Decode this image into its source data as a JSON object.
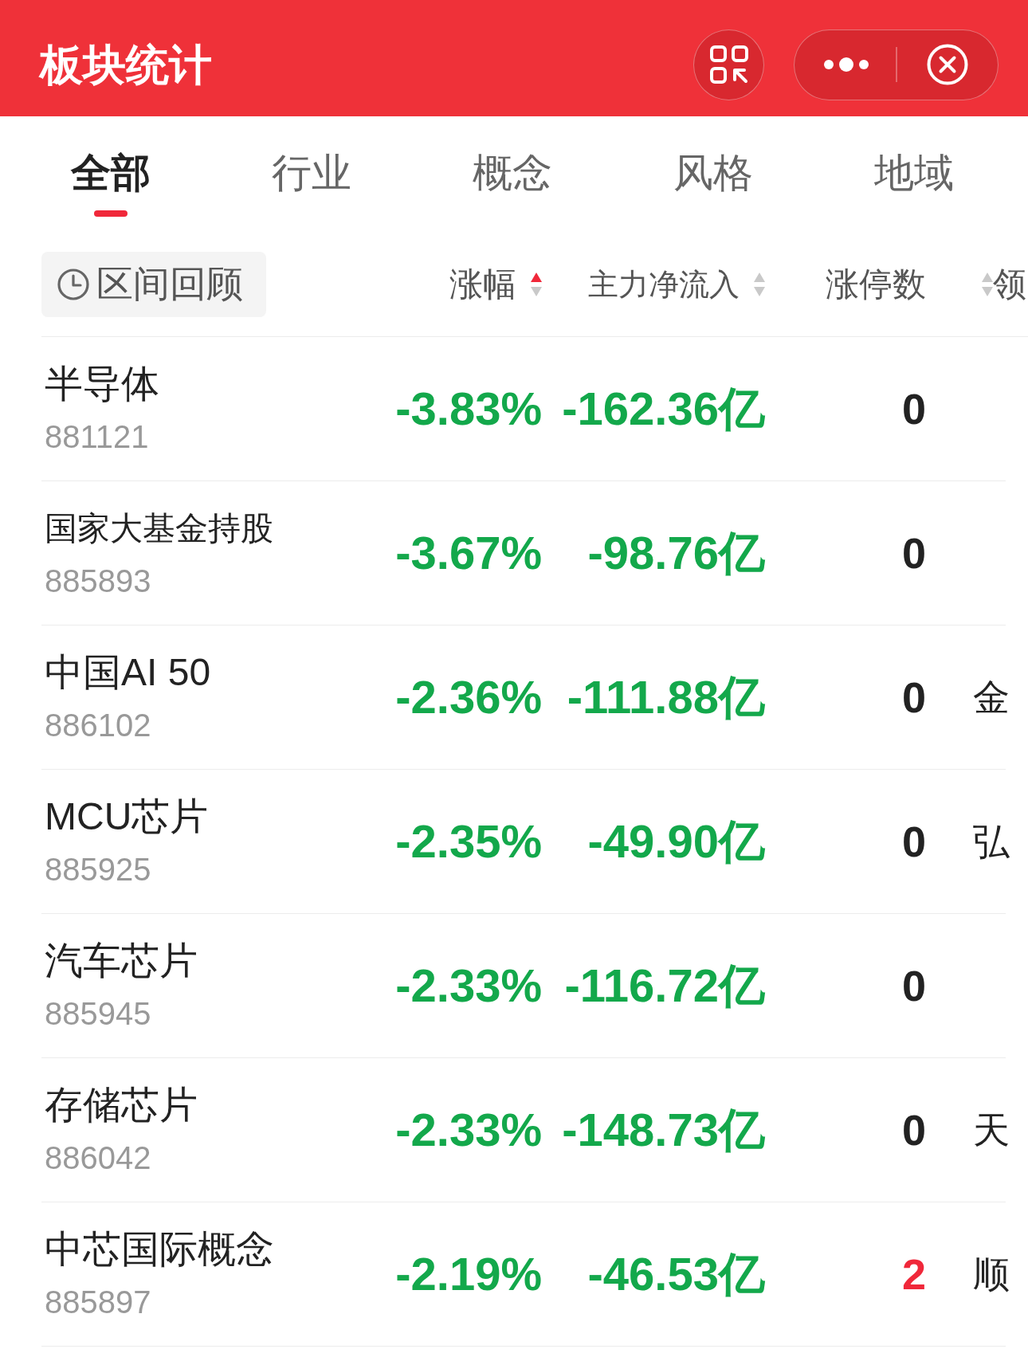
{
  "header": {
    "title": "板块统计"
  },
  "tabs": [
    {
      "label": "全部",
      "selected": true
    },
    {
      "label": "行业",
      "selected": false
    },
    {
      "label": "概念",
      "selected": false
    },
    {
      "label": "风格",
      "selected": false
    },
    {
      "label": "地域",
      "selected": false
    }
  ],
  "filter": {
    "label": "区间回顾"
  },
  "columns": [
    {
      "label": "涨幅",
      "sort_ascending": true,
      "sort_descending": false
    },
    {
      "label": "主力净流入",
      "sort_ascending": false,
      "sort_descending": false
    },
    {
      "label": "涨停数"
    },
    {
      "label": "领",
      "sort_ascending": false,
      "sort_descending": false
    }
  ],
  "rows": [
    {
      "name": "半导体",
      "code": "881121",
      "change": "-3.83%",
      "change_falling": true,
      "inflow": "-162.36亿",
      "inflow_falling": true,
      "limit_up": "0",
      "limit_up_highlighted": false
    },
    {
      "name": "国家大基金持股",
      "code": "885893",
      "change": "-3.67%",
      "change_falling": true,
      "inflow": "-98.76亿",
      "inflow_falling": true,
      "limit_up": "0",
      "limit_up_highlighted": false
    },
    {
      "name": "中国AI 50",
      "code": "886102",
      "change": "-2.36%",
      "change_falling": true,
      "inflow": "-111.88亿",
      "inflow_falling": true,
      "limit_up": "0",
      "limit_up_highlighted": false,
      "leader": "金"
    },
    {
      "name": "MCU芯片",
      "code": "885925",
      "change": "-2.35%",
      "change_falling": true,
      "inflow": "-49.90亿",
      "inflow_falling": true,
      "limit_up": "0",
      "limit_up_highlighted": false,
      "leader": "弘"
    },
    {
      "name": "汽车芯片",
      "code": "885945",
      "change": "-2.33%",
      "change_falling": true,
      "inflow": "-116.72亿",
      "inflow_falling": true,
      "limit_up": "0",
      "limit_up_highlighted": false
    },
    {
      "name": "存储芯片",
      "code": "886042",
      "change": "-2.33%",
      "change_falling": true,
      "inflow": "-148.73亿",
      "inflow_falling": true,
      "limit_up": "0",
      "limit_up_highlighted": false,
      "leader": "天"
    },
    {
      "name": "中芯国际概念",
      "code": "885897",
      "change": "-2.19%",
      "change_falling": true,
      "inflow": "-46.53亿",
      "inflow_falling": true,
      "limit_up": "2",
      "limit_up_highlighted": true,
      "leader": "顺"
    }
  ]
}
